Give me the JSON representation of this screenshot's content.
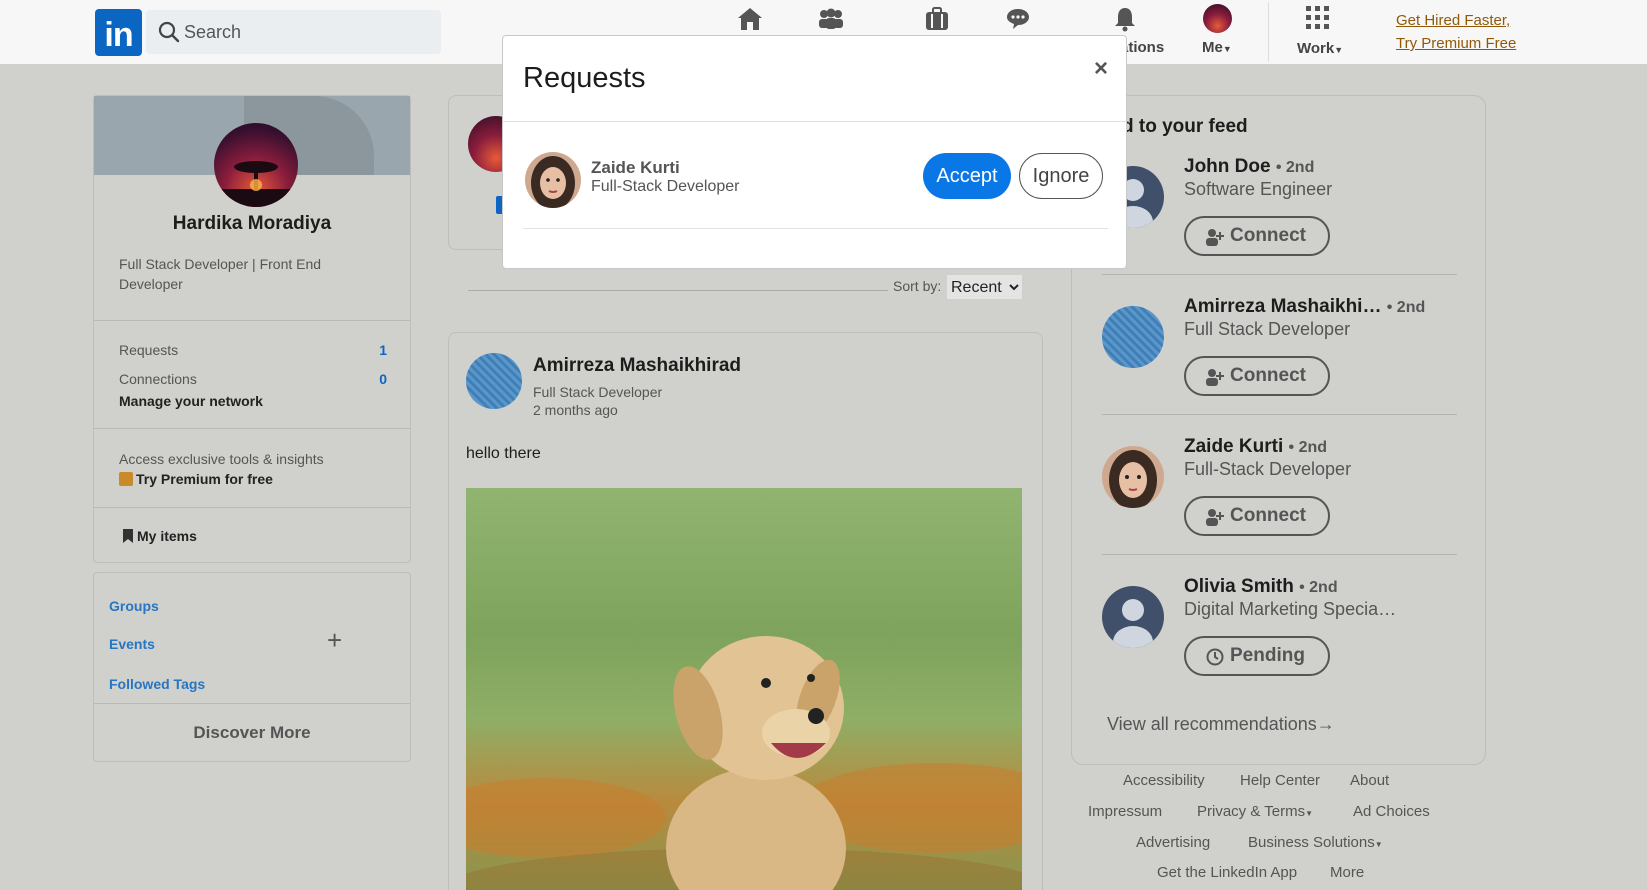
{
  "nav": {
    "search_placeholder": "Search",
    "notifications_label": "ations",
    "me_label": "Me",
    "work_label": "Work",
    "premium_line1": "Get Hired Faster,",
    "premium_line2": "Try Premium Free",
    "logo_text": "in"
  },
  "profile": {
    "name": "Hardika Moradiya",
    "headline": "Full Stack Developer | Front End Developer",
    "requests_label": "Requests",
    "requests_count": "1",
    "connections_label": "Connections",
    "connections_count": "0",
    "manage_label": "Manage your network",
    "access_label": "Access exclusive tools & insights",
    "try_premium_label": "Try Premium for free",
    "my_items_label": "My items"
  },
  "groups": {
    "items": [
      "Groups",
      "Events",
      "Followed Tags"
    ],
    "discover_label": "Discover More"
  },
  "feed": {
    "sort_label": "Sort by:",
    "sort_value": "Recent",
    "post": {
      "author": "Amirreza Mashaikhirad",
      "subtitle": "Full Stack Developer",
      "time": "2 months ago",
      "text": "hello there"
    }
  },
  "recommendations": {
    "title": "d to your feed",
    "items": [
      {
        "name": "John Doe",
        "degree": "• 2nd",
        "title": "Software Engineer",
        "button": "Connect"
      },
      {
        "name": "Amirreza Mashaikhi…",
        "degree": "• 2nd",
        "title": "Full Stack Developer",
        "button": "Connect"
      },
      {
        "name": "Zaide Kurti",
        "degree": "• 2nd",
        "title": "Full-Stack Developer",
        "button": "Connect"
      },
      {
        "name": "Olivia Smith",
        "degree": "• 2nd",
        "title": "Digital Marketing Specia…",
        "button": "Pending"
      }
    ],
    "view_all": "View all recommendations"
  },
  "footer": {
    "links": [
      "Accessibility",
      "Help Center",
      "About",
      "Impressum",
      "Privacy & Terms",
      "Ad Choices",
      "Advertising",
      "Business Solutions",
      "Get the LinkedIn App",
      "More"
    ]
  },
  "modal": {
    "title": "Requests",
    "close": "×",
    "request": {
      "name": "Zaide Kurti",
      "title": "Full-Stack Developer"
    },
    "accept_label": "Accept",
    "ignore_label": "Ignore"
  },
  "colors": {
    "brand": "#0a66c2",
    "accept": "#0a77e6",
    "premium_link": "#915907"
  }
}
